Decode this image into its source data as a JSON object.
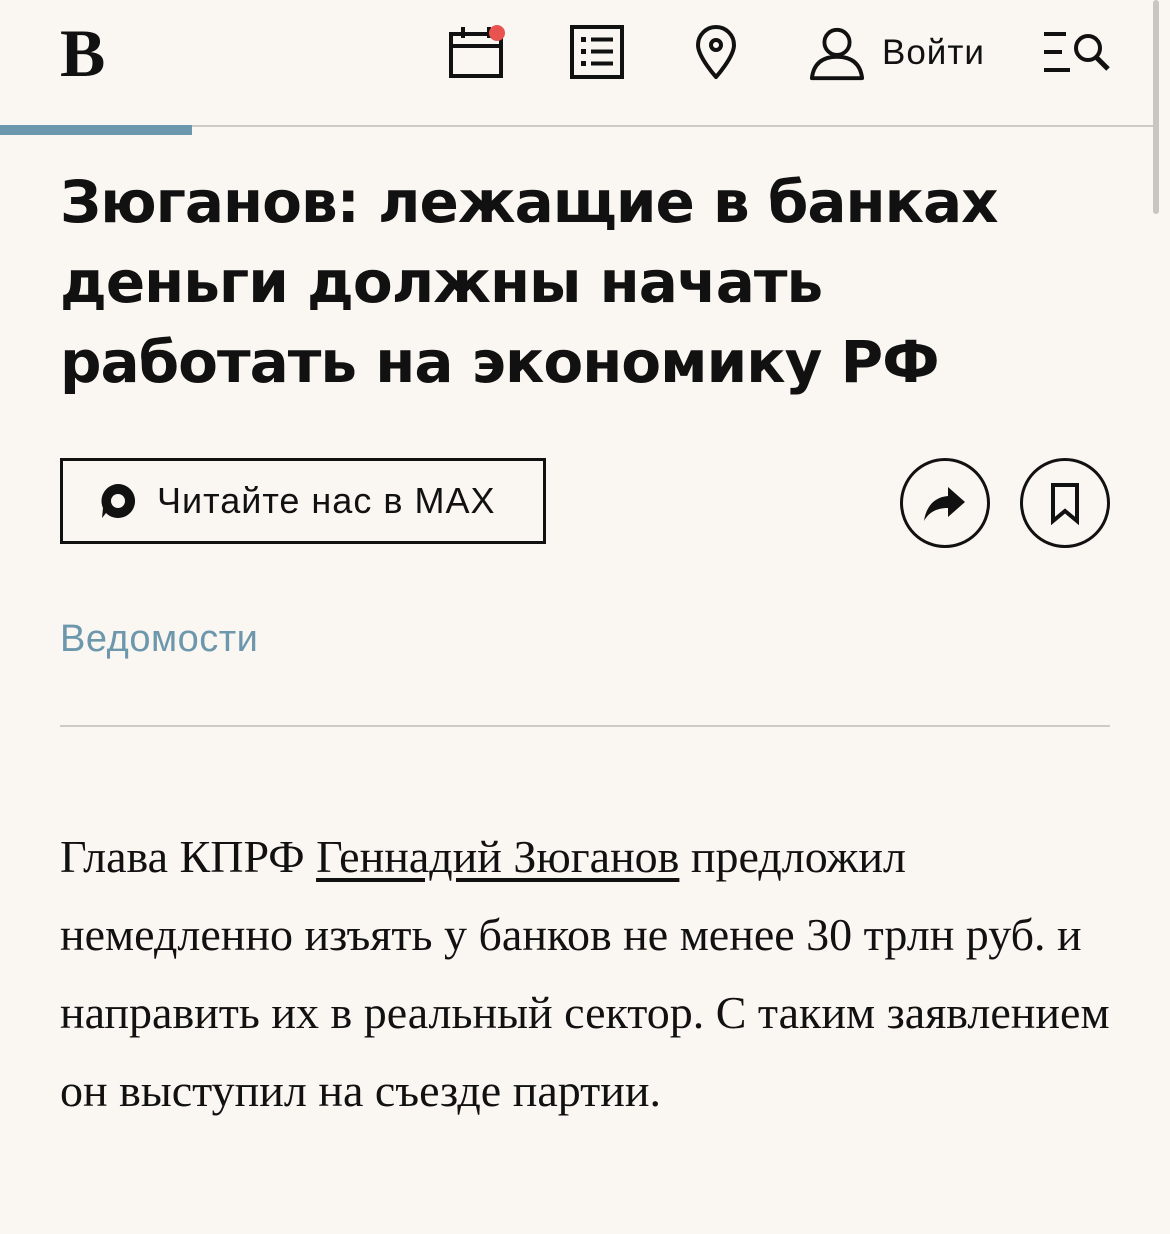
{
  "header": {
    "logo": "В",
    "login_label": "Войти",
    "icons": [
      "calendar-icon",
      "list-icon",
      "location-pin-icon",
      "user-icon",
      "menu-search-icon"
    ],
    "notification_color": "#e9534f",
    "reading_progress_color": "#6d97ac"
  },
  "article": {
    "title": "Зюганов: лежащие в банках деньги должны начать работать на экономику РФ",
    "max_button_label": "Читайте нас в MAX",
    "source": "Ведомости",
    "body": {
      "part1": "Глава КПРФ ",
      "link": "Геннадий Зюганов",
      "part2": " предложил немедленно изъять у банков не менее 30 трлн руб. и направить их в реальный сектор. С таким заявлением он выступил на съезде партии."
    }
  },
  "colors": {
    "background": "#faf6f2",
    "accent": "#6d97ac",
    "text": "#111111"
  }
}
